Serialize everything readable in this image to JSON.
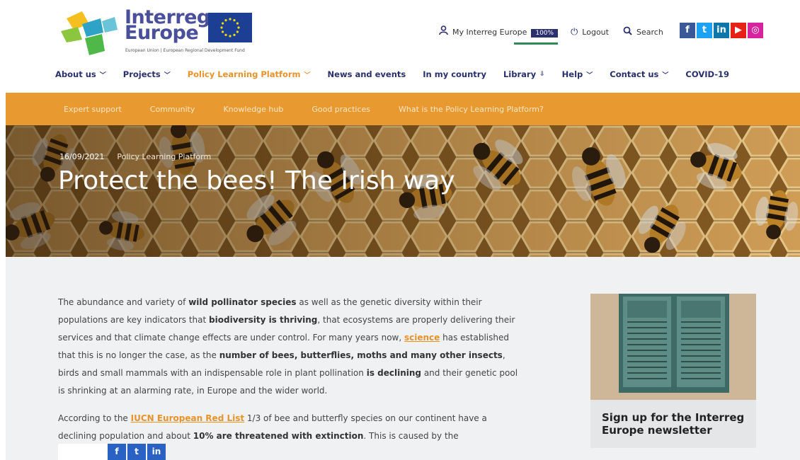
{
  "logo": {
    "line1": "Interreg",
    "line2": "Europe",
    "subtitle": "European Union | European Regional Development Fund"
  },
  "utility": {
    "my_interreg": "My Interreg Europe",
    "progress_pct": "100%",
    "progress_value": 100,
    "logout": "Logout",
    "search": "Search"
  },
  "socials": [
    {
      "icon": "facebook-icon",
      "glyph": "f",
      "color": "#3b5998"
    },
    {
      "icon": "twitter-icon",
      "glyph": "t",
      "color": "#1da1f2"
    },
    {
      "icon": "linkedin-icon",
      "glyph": "in",
      "color": "#0e76a8"
    },
    {
      "icon": "youtube-icon",
      "glyph": "▶",
      "color": "#e62117"
    },
    {
      "icon": "instagram-icon",
      "glyph": "◎",
      "color": "#d6249f"
    }
  ],
  "mainnav": {
    "about": "About us",
    "projects": "Projects",
    "plp": "Policy Learning Platform",
    "news": "News and events",
    "country": "In my country",
    "library": "Library",
    "help": "Help",
    "contact": "Contact us",
    "covid": "COVID-19"
  },
  "subnav": {
    "expert": "Expert support",
    "community": "Community",
    "knowledge": "Knowledge hub",
    "practices": "Good practices",
    "what": "What is the Policy Learning Platform?"
  },
  "hero": {
    "date": "16/09/2021",
    "category": "Policy Learning Platform",
    "title": "Protect the bees! The Irish way"
  },
  "article": {
    "p1": {
      "t1": "The abundance and variety of ",
      "b1": "wild pollinator species",
      "t2": " as well as the genetic diversity within their populations are key indicators that ",
      "b2": "biodiversity is thriving",
      "t3": ", that ecosystems are properly delivering their services and that climate change effects are under control. For many years now, ",
      "link": "science",
      "t4": " has established that this is no longer the case, as the ",
      "b3": "number of bees, butterflies, moths and many other insects",
      "t5": ", birds and small mammals with an indispensable role in plant pollination ",
      "b4": "is declining",
      "t6": " and their genetic pool is shrinking at an alarming rate, in Europe and the wider world."
    },
    "p2": {
      "t1": "According to the ",
      "link": "IUCN European Red List",
      "t2": " 1/3 of bee and butterfly species on our continent have a declining population and about ",
      "b1": "10% are threatened with extinction",
      "t3": ". This is caused by the"
    }
  },
  "promo": {
    "title": "Sign up for the Interreg Europe newsletter"
  },
  "colors": {
    "brand_navy": "#2a2f6e",
    "brand_orange": "#e8992f",
    "content_bg": "#eff1f3"
  }
}
